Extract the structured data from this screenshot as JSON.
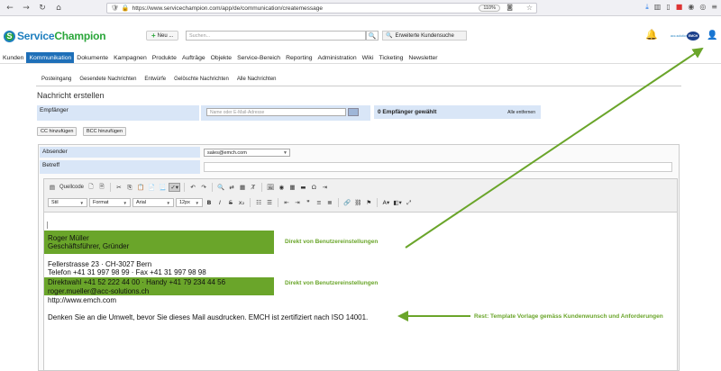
{
  "browser": {
    "url": "https://www.servicechampion.com/app/de/communication/createmessage",
    "zoom": "110%"
  },
  "header": {
    "logo_service": "Service",
    "logo_champion": "Champion",
    "new_label": "Neu ...",
    "search_placeholder": "Suchen...",
    "extended_search": "Erweiterte Kundensuche",
    "brand_mini": "acc-solutions",
    "emch_logo": "EMCH"
  },
  "menu": [
    {
      "label": "Kunden",
      "active": false
    },
    {
      "label": "Kommunikation",
      "active": true
    },
    {
      "label": "Dokumente",
      "active": false
    },
    {
      "label": "Kampagnen",
      "active": false
    },
    {
      "label": "Produkte",
      "active": false
    },
    {
      "label": "Aufträge",
      "active": false
    },
    {
      "label": "Objekte",
      "active": false
    },
    {
      "label": "Service-Bereich",
      "active": false
    },
    {
      "label": "Reporting",
      "active": false
    },
    {
      "label": "Administration",
      "active": false
    },
    {
      "label": "Wiki",
      "active": false
    },
    {
      "label": "Ticketing",
      "active": false
    },
    {
      "label": "Newsletter",
      "active": false
    }
  ],
  "subtabs": [
    "Posteingang",
    "Gesendete Nachrichten",
    "Entwürfe",
    "Gelöschte Nachrichten",
    "Alle Nachrichten"
  ],
  "page_title": "Nachricht erstellen",
  "recipients": {
    "label": "Empfänger",
    "placeholder": "Name oder E-Mail-Adresse",
    "count_text": "0 Empfänger gewählt",
    "remove_all": "Alle entfernen"
  },
  "cc_label": "CC hinzufügen",
  "bcc_label": "BCC hinzufügen",
  "sender": {
    "label": "Absender",
    "value": "sales@emch.com"
  },
  "subject": {
    "label": "Betreff"
  },
  "toolbar": {
    "source": "Quellcode",
    "style": "Stil",
    "format": "Format",
    "font": "Arial",
    "size": "12px"
  },
  "signature": {
    "name": "Roger Müller",
    "role": "Geschäftsführer, Gründer",
    "address": "Fellerstrasse 23 · CH-3027 Bern",
    "phone": "Telefon +41 31 997 98 99 · Fax +41 31 997 98 98",
    "direct": "Direktwahl +41 52 222 44 00 · Handy +41 79 234 44 56",
    "email": "roger.mueller@acc-solutions.ch",
    "web": "http://www.emch.com",
    "footer": "Denken Sie an die Umwelt, bevor Sie dieses Mail ausdrucken. EMCH ist zertifiziert nach ISO 14001."
  },
  "annotations": {
    "a1": "Direkt von Benutzereinstellungen",
    "a2": "Direkt von Benutzereinstellungen",
    "a3": "Rest: Template Vorlage gemäss Kundenwunsch und Anforderungen"
  }
}
